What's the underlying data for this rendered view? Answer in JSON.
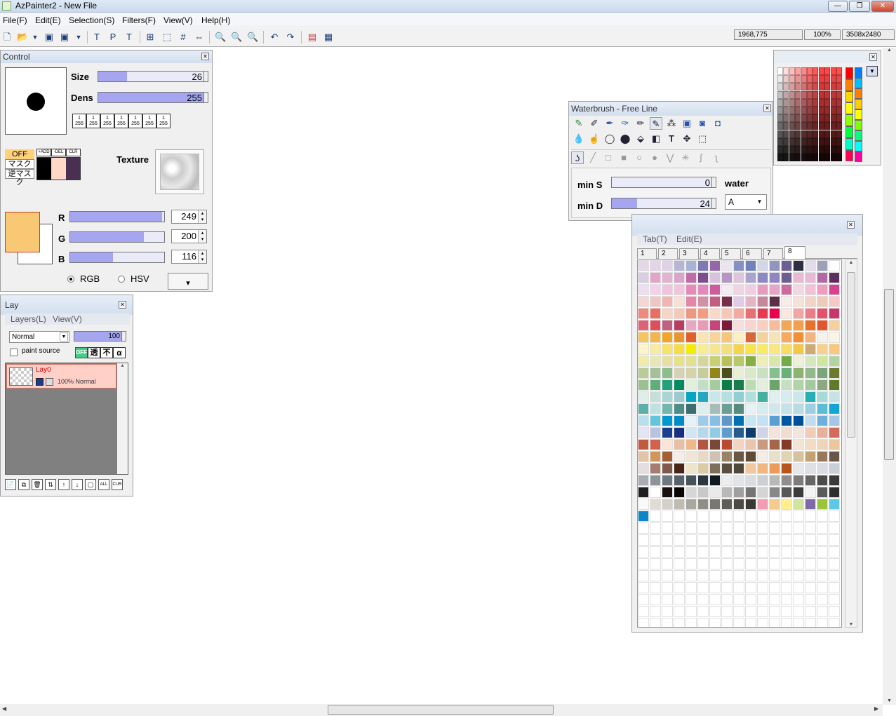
{
  "window": {
    "title": "AzPainter2 - New File",
    "min": "—",
    "max": "❐",
    "close": "✕"
  },
  "menu": {
    "items": [
      "File(F)",
      "Edit(E)",
      "Selection(S)",
      "Filters(F)",
      "View(V)",
      "Help(H)"
    ]
  },
  "status": {
    "coords": "1968,775",
    "zoom": "100%",
    "size": "3508x2480"
  },
  "control": {
    "title": "Control",
    "size_label": "Size",
    "size_value": "26",
    "size_fraction": 0.26,
    "dens_label": "Dens",
    "dens_value": "255",
    "dens_fraction": 1.0,
    "presets": [
      "1\n255",
      "1\n255",
      "1\n255",
      "1\n255",
      "1\n255",
      "1\n255",
      "1\n255"
    ],
    "mask_off": "OFF",
    "mask": "マスク",
    "inv_mask": "逆マスク",
    "mask_add": "+ADD",
    "mask_del": "-DEL",
    "mask_clr": "CLR",
    "texture_label": "Texture",
    "r_label": "R",
    "g_label": "G",
    "b_label": "B",
    "r_value": "249",
    "g_value": "200",
    "b_value": "116",
    "rgb_label": "RGB",
    "hsv_label": "HSV",
    "dropdown": "▾",
    "fg_color": "#f9c874",
    "mask_colors": [
      "#000000",
      "#ffd8c8",
      "#4a3050"
    ]
  },
  "layers": {
    "title": "Lay",
    "menu_layers": "Layers(L)",
    "menu_view": "View(V)",
    "blend": "Normal",
    "opacity": "100",
    "paint_source": "paint source",
    "btn_off": "OFF",
    "btn_t": "透",
    "btn_f": "不",
    "btn_a": "α",
    "layer_name": "Lay0",
    "layer_info": "100% Normal",
    "bottom_buttons": [
      "📄",
      "⧉",
      "🗑",
      "⇅",
      "↑",
      "↓",
      "▢",
      "ALL",
      "CUR"
    ]
  },
  "waterbrush": {
    "title": "Waterbrush - Free Line",
    "min_s_label": "min S",
    "min_s_value": "0",
    "min_s_fraction": 0.0,
    "min_d_label": "min D",
    "min_d_value": "24",
    "min_d_fraction": 0.24,
    "water_label": "water",
    "water_mode": "A"
  },
  "palette": {
    "menu_tab": "Tab(T)",
    "menu_edit": "Edit(E)",
    "tabs": [
      "1",
      "2",
      "3",
      "4",
      "5",
      "6",
      "7",
      "8"
    ],
    "active_tab": "8"
  },
  "palette_colors": [
    [
      "#e3d8ea",
      "#e4d4e8",
      "#ddd2e6",
      "#b8b4d4",
      "#a7b3d6",
      "#7e78b3",
      "#9468a8",
      "#eae6f0",
      "#8790c4",
      "#7181bd",
      "#d2d6e6",
      "#9096c0",
      "#6b5f93",
      "#2c3040",
      "#e2dbe8",
      "#9e9fb9",
      "#ffffff"
    ],
    [
      "#d9cde3",
      "#e6a3c8",
      "#e2b4d1",
      "#d9a6c9",
      "#c36aa8",
      "#7d4e8f",
      "#d7c2dd",
      "#b695c5",
      "#dcc5dd",
      "#a9a3cd",
      "#8c89c4",
      "#8e85c2",
      "#6e5d92",
      "#e8b9d2",
      "#e6bad4",
      "#b06aa3",
      "#5b2e5f"
    ],
    [
      "#eedff0",
      "#f3d1e8",
      "#f0c3de",
      "#f1c5de",
      "#e88ab9",
      "#e488bc",
      "#cf5b9c",
      "#f3eaf4",
      "#f1d4e4",
      "#f1cde1",
      "#e89bbf",
      "#e6a4c6",
      "#cd6c9c",
      "#f0d8e4",
      "#f2c1d5",
      "#ee9dbf",
      "#d8418c"
    ],
    [
      "#f4d6d5",
      "#f0c5c2",
      "#f2b4b0",
      "#f7e0d6",
      "#e784a9",
      "#d190a4",
      "#c55d83",
      "#7a2e4b",
      "#dfcce6",
      "#e9b3c7",
      "#c6889c",
      "#5b3046",
      "#f8ece6",
      "#f6e1d8",
      "#f3d3c6",
      "#eecab9",
      "#f5c9c4"
    ],
    [
      "#ef8a7c",
      "#ea6f5e",
      "#f7d4c4",
      "#f6c8b7",
      "#f0977f",
      "#f49b80",
      "#fad8c6",
      "#f6c7b6",
      "#f3aaa0",
      "#ea6f73",
      "#e43d51",
      "#e8014c",
      "#fce6e0",
      "#f2a6a2",
      "#ec7d89",
      "#e5506a",
      "#c73868"
    ],
    [
      "#df6178",
      "#e04c5c",
      "#c2607d",
      "#b63c62",
      "#e6a8c0",
      "#e79bb7",
      "#c8457c",
      "#7a1b3a",
      "#f7dfe0",
      "#f8d5ce",
      "#f7cfc3",
      "#f8bc9a",
      "#f3a655",
      "#f2a04b",
      "#e8712b",
      "#e5552e",
      "#f7d0a0"
    ],
    [
      "#f7c35c",
      "#f3b54c",
      "#f1a628",
      "#ea962d",
      "#e35f29",
      "#fbe3b2",
      "#f8d499",
      "#f7c777",
      "#fbf0c0",
      "#d96637",
      "#f4d39b",
      "#f7e3b6",
      "#f7a960",
      "#f38f33",
      "#f4b480",
      "#f6f1ea",
      "#fbf3e6"
    ],
    [
      "#fdf5c8",
      "#f9eba4",
      "#f5e36c",
      "#f6dc45",
      "#f5ec00",
      "#f8ee90",
      "#f5e88c",
      "#f2e07c",
      "#f4d64e",
      "#f8e447",
      "#fbea66",
      "#f9e780",
      "#f7dd66",
      "#f3c845",
      "#cfaa77",
      "#f7d18c",
      "#f9c87f"
    ],
    [
      "#f1eca8",
      "#e9e7b0",
      "#e7e0a0",
      "#e6e288",
      "#e1e090",
      "#d5d79a",
      "#c9d072",
      "#b9c256",
      "#b8c96a",
      "#86b140",
      "#eeefb6",
      "#d7e8a8",
      "#73ab44",
      "#ecf1d8",
      "#d5e7be",
      "#cde79c",
      "#b3d3a4"
    ],
    [
      "#b9cc97",
      "#a3c198",
      "#8ebd8b",
      "#d6d2b2",
      "#d4d3a9",
      "#c5ce9a",
      "#928618",
      "#4b4f1d",
      "#e8efd5",
      "#d8eac8",
      "#c9e0c0",
      "#86c08e",
      "#6ab07a",
      "#8eb36e",
      "#92b98c",
      "#7ba37c",
      "#6b7a2c"
    ],
    [
      "#9ac190",
      "#62ae7b",
      "#24a07a",
      "#008c5e",
      "#dff0dc",
      "#c0e0c4",
      "#a4cc9e",
      "#0a7e45",
      "#187c4d",
      "#bddcb0",
      "#e3efda",
      "#69a66a",
      "#c4e0c0",
      "#b0d4a8",
      "#a4c8a0",
      "#8ea882",
      "#5f7a28"
    ],
    [
      "#e0eeea",
      "#c6dfd9",
      "#a7d6d6",
      "#9bcbcf",
      "#04a7c3",
      "#24a7c0",
      "#c8e8e8",
      "#b5e0e0",
      "#90d0d4",
      "#b0e0dc",
      "#44b0a0",
      "#dff0ee",
      "#d6ecf0",
      "#c9e8ec",
      "#26b0b6",
      "#a6dad6",
      "#c6e2e4"
    ],
    [
      "#5cb0ac",
      "#bee1e3",
      "#72b6b0",
      "#4e8c88",
      "#3a6e70",
      "#deeeee",
      "#a8bcba",
      "#6c9e98",
      "#568c80",
      "#e6f2f4",
      "#d6ecf0",
      "#d0e8ec",
      "#c4e2e8",
      "#b6dce4",
      "#9cd0e0",
      "#5bbcd4",
      "#12a5d6"
    ],
    [
      "#b8e0ec",
      "#62c6e0",
      "#0098d0",
      "#008cc4",
      "#e6f2fa",
      "#9ecbea",
      "#88bde4",
      "#5d98c8",
      "#0072b2",
      "#c8e6f2",
      "#c4e2f0",
      "#5a9fd4",
      "#0058a0",
      "#004f99",
      "#c2dcee",
      "#6cb0dc",
      "#a5c6e6"
    ],
    [
      "#e3e5f4",
      "#b7c3e2",
      "#1a3f8f",
      "#17307f",
      "#d2e5f2",
      "#b5d8ec",
      "#90cce6",
      "#5d9dd0",
      "#265d8a",
      "#0d3d6c",
      "#d1d3e8",
      "#f4e4dc",
      "#f2dcd2",
      "#f2e6e0",
      "#f0cdb8",
      "#e8b09a",
      "#d36a5a"
    ],
    [
      "#c25a3e",
      "#d4614b",
      "#fbe4d8",
      "#e8bfa2",
      "#f0b889",
      "#b55544",
      "#7a4836",
      "#ba4b2e",
      "#f2d4c4",
      "#eac6b0",
      "#c89a80",
      "#a4664a",
      "#843a24",
      "#f4e4d4",
      "#f2dcc4",
      "#eed4b8",
      "#ecc69c"
    ],
    [
      "#e4c4a6",
      "#d2955a",
      "#a46032",
      "#f6ede6",
      "#f2e4d6",
      "#e8d8c4",
      "#cfc2b4",
      "#9a8466",
      "#6a5840",
      "#604a34",
      "#f2eee6",
      "#e8e0c8",
      "#e2d4b0",
      "#d6c29e",
      "#c4a272",
      "#98785a",
      "#6a5648"
    ],
    [
      "#e5dede",
      "#a67c70",
      "#7e5a4c",
      "#4a2414",
      "#efe4c8",
      "#dccca6",
      "#7e6e5a",
      "#58503c",
      "#504838",
      "#f0c8a0",
      "#f0b880",
      "#ec9c58",
      "#b8541c",
      "#e8e8ec",
      "#dee0e6",
      "#d8dde4",
      "#c8ced6"
    ],
    [
      "#a8adb4",
      "#8c9499",
      "#6e7880",
      "#57626c",
      "#46525c",
      "#2e3640",
      "#121a20",
      "#ecedef",
      "#e2e4e8",
      "#dadde0",
      "#cccfd4",
      "#b8b8b6",
      "#8f8e8c",
      "#7e7c7a",
      "#686664",
      "#4e4c4a",
      "#3c3a38"
    ],
    [
      "#1e1e20",
      "#ffffff",
      "#1a1010",
      "#0a0606",
      "#d6d6d6",
      "#c8c8c8",
      "#eaeaea",
      "#b8b8b8",
      "#a0a0a0",
      "#747474",
      "#d4d4d4",
      "#888888",
      "#585858",
      "#3c3c3c",
      "#f4f4f4",
      "#5a5a5a",
      "#2e2e2e"
    ],
    [
      "#fafafa",
      "#e0dcd4",
      "#d4d0c8",
      "#c0bcb4",
      "#a8a8a0",
      "#908e86",
      "#787670",
      "#605e58",
      "#4c4a44",
      "#3a3830",
      "#f49cb6",
      "#f6cb8c",
      "#fff08c",
      "#d0e4a0",
      "#7e6aa6",
      "#9cc43a",
      "#5ec6e6"
    ],
    [
      "#0d86c8"
    ]
  ],
  "color_picker": {
    "hue_colors": [
      "#ff0000",
      "#ff8000",
      "#ffd800",
      "#ffff00",
      "#90ff00",
      "#00ff40",
      "#00ffc8",
      "#ff0050"
    ],
    "hue2_colors": [
      "#0080ff",
      "#00c0ff",
      "#ff8000",
      "#ffcc00",
      "#ffff00",
      "#80ff00",
      "#00ff80",
      "#00ffff",
      "#ff00a0"
    ]
  }
}
